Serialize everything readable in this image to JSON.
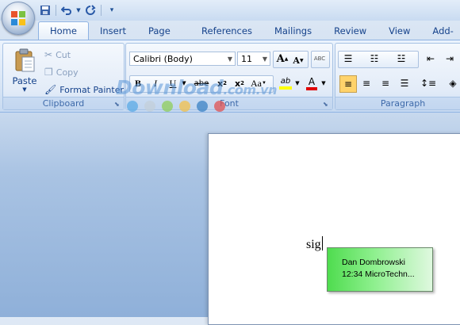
{
  "quick_access": {
    "save_icon": "floppy-disk-icon",
    "undo_icon": "undo-icon",
    "redo_icon": "redo-icon",
    "customize_icon": "chevron-down-icon"
  },
  "tabs": [
    {
      "label": "Home",
      "active": true
    },
    {
      "label": "Insert"
    },
    {
      "label": "Page Layout"
    },
    {
      "label": "References"
    },
    {
      "label": "Mailings"
    },
    {
      "label": "Review"
    },
    {
      "label": "View"
    },
    {
      "label": "Add-In"
    }
  ],
  "clipboard": {
    "group_label": "Clipboard",
    "paste_label": "Paste",
    "cut_label": "Cut",
    "copy_label": "Copy",
    "format_painter_label": "Format Painter"
  },
  "font": {
    "group_label": "Font",
    "font_name": "Calibri (Body)",
    "font_size": "11",
    "grow_label": "A",
    "shrink_label": "A",
    "bold_label": "B",
    "italic_label": "I",
    "underline_label": "U",
    "strike_label": "abe",
    "subscript_label": "x",
    "superscript_label": "x",
    "subscript_mark": "2",
    "superscript_mark": "2",
    "change_case_label": "Aa",
    "highlight_label": "ab",
    "font_color_label": "A",
    "clear_format_label": "ABC"
  },
  "paragraph": {
    "group_label": "Paragraph"
  },
  "watermark": {
    "text": "Download",
    "suffix": ".com.vn"
  },
  "watermark_dot_colors": [
    "#5aa9e6",
    "#c3cfd9",
    "#8fce5a",
    "#f3c04a",
    "#3a82c4",
    "#e05252"
  ],
  "document": {
    "typed_text": "sig"
  },
  "autocomplete": {
    "line1": "Dan Dombrowski",
    "line2": "12:34 MicroTechn..."
  },
  "colors": {
    "highlight": "#ffff00",
    "font_color": "#e00000",
    "tooltip_green": "#4fdc4f"
  }
}
